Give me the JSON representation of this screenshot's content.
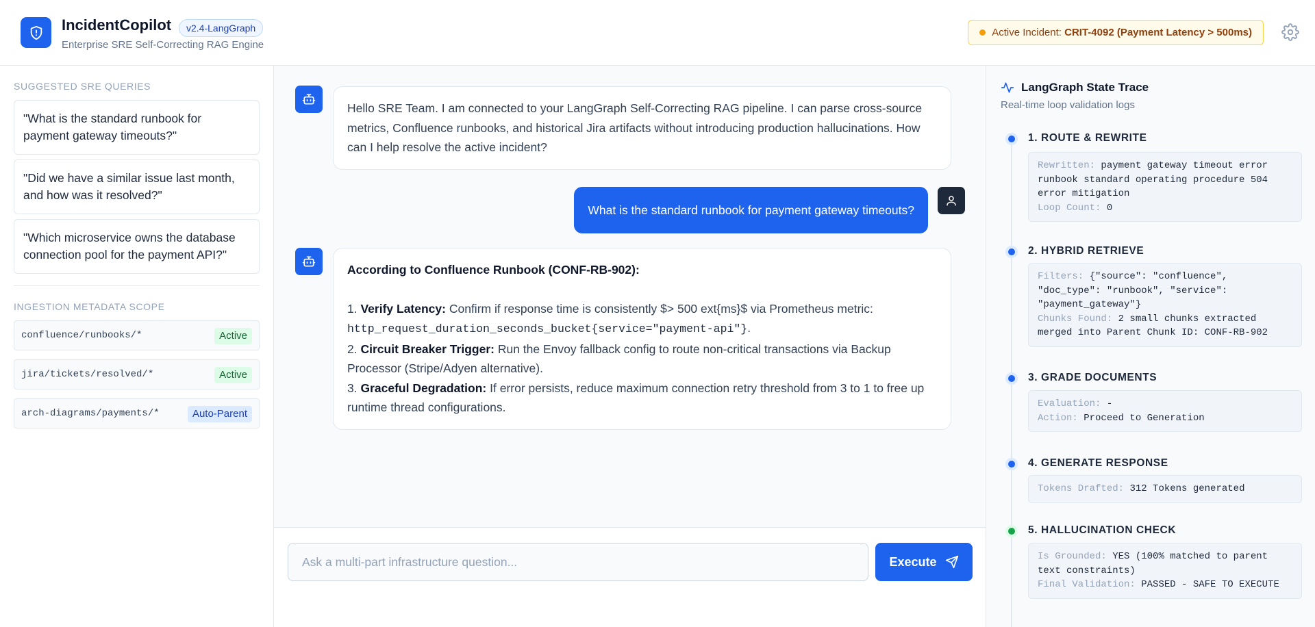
{
  "header": {
    "title": "IncidentCopilot",
    "version": "v2.4-LangGraph",
    "subtitle": "Enterprise SRE Self-Correcting RAG Engine",
    "incident_label": "Active Incident:",
    "incident_value": "CRIT-4092 (Payment Latency > 500ms)"
  },
  "sidebar": {
    "queries_title": "SUGGESTED SRE QUERIES",
    "queries": [
      "\"What is the standard runbook for payment gateway timeouts?\"",
      "\"Did we have a similar issue last month, and how was it resolved?\"",
      "\"Which microservice owns the database connection pool for the payment API?\""
    ],
    "metadata_title": "INGESTION METADATA SCOPE",
    "metadata": [
      {
        "path": "confluence/runbooks/*",
        "status": "Active"
      },
      {
        "path": "jira/tickets/resolved/*",
        "status": "Active"
      },
      {
        "path": "arch-diagrams/payments/*",
        "status": "Auto-Parent"
      }
    ]
  },
  "chat": {
    "greeting": "Hello SRE Team. I am connected to your LangGraph Self-Correcting RAG pipeline. I can parse cross-source metrics, Confluence runbooks, and historical Jira artifacts without introducing production hallucinations. How can I help resolve the active incident?",
    "user_message": "What is the standard runbook for payment gateway timeouts?",
    "answer": {
      "heading": "According to Confluence Runbook (CONF-RB-902):",
      "step1_label": "Verify Latency:",
      "step1_text": "Confirm if response time is consistently $> 500 ext{ms}$ via Prometheus metric:",
      "step1_code": "http_request_duration_seconds_bucket{service=\"payment-api\"}",
      "step2_label": "Circuit Breaker Trigger:",
      "step2_text": "Run the Envoy fallback config to route non-critical transactions via Backup Processor (Stripe/Adyen alternative).",
      "step3_label": "Graceful Degradation:",
      "step3_text": "If error persists, reduce maximum connection retry threshold from 3 to 1 to free up runtime thread configurations."
    },
    "input_placeholder": "Ask a multi-part infrastructure question...",
    "execute_label": "Execute"
  },
  "trace": {
    "title": "LangGraph State Trace",
    "subtitle": "Real-time loop validation logs",
    "steps": [
      {
        "title": "1. ROUTE & REWRITE",
        "k1": "Rewritten:",
        "v1": "payment gateway timeout error runbook standard operating procedure 504 error mitigation",
        "k2": "Loop Count:",
        "v2": "0"
      },
      {
        "title": "2. HYBRID RETRIEVE",
        "k1": "Filters:",
        "v1": "{\"source\": \"confluence\", \"doc_type\": \"runbook\", \"service\": \"payment_gateway\"}",
        "k2": "Chunks Found:",
        "v2": "2 small chunks extracted merged into Parent Chunk ID: CONF-RB-902"
      },
      {
        "title": "3. GRADE DOCUMENTS",
        "k1": "Evaluation:",
        "v1": "-",
        "k2": "Action:",
        "v2": "Proceed to Generation"
      },
      {
        "title": "4. GENERATE RESPONSE",
        "k1": "Tokens Drafted:",
        "v1": "312 Tokens generated"
      },
      {
        "title": "5. HALLUCINATION CHECK",
        "k1": "Is Grounded:",
        "v1": "YES (100% matched to parent text constraints)",
        "k2": "Final Validation:",
        "v2": "PASSED - SAFE TO EXECUTE"
      }
    ]
  },
  "colors": {
    "accent": "#1d63ed",
    "warning": "#f59e0b",
    "success": "#16a34a"
  }
}
